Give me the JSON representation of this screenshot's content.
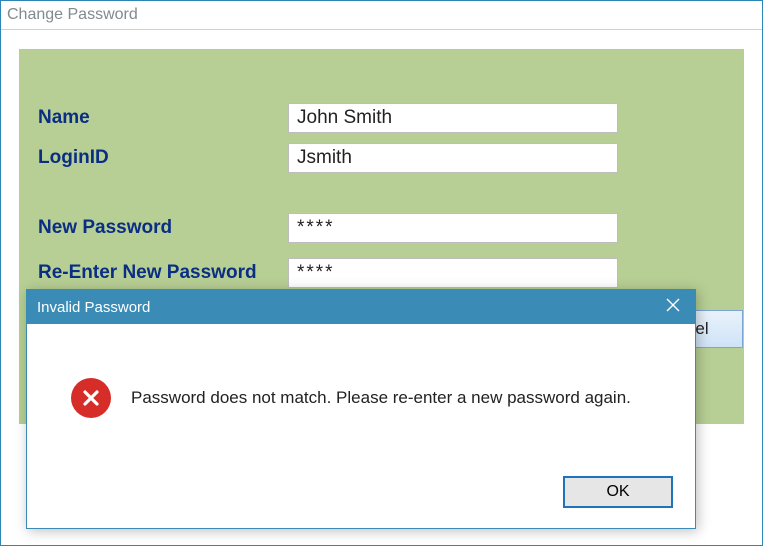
{
  "window": {
    "title": "Change Password"
  },
  "form": {
    "name_label": "Name",
    "name_value": "John Smith",
    "login_label": "LoginID",
    "login_value": "Jsmith",
    "newpw_label": "New Password",
    "newpw_value": "****",
    "repw_label": "Re-Enter New Password",
    "repw_value": "****",
    "cancel_label": "ncel"
  },
  "dialog": {
    "title": "Invalid Password",
    "message": "Password does not match. Please re-enter a new password again.",
    "ok_label": "OK"
  }
}
